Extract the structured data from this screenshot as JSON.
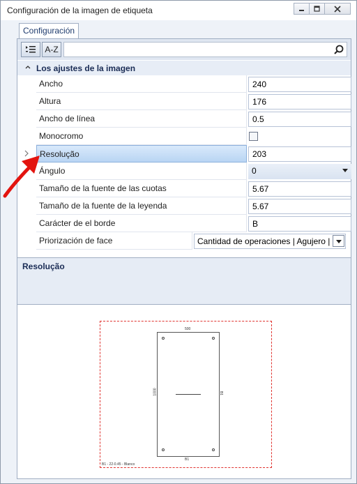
{
  "window": {
    "title": "Configuración de la imagen de etiqueta",
    "buttons": [
      "minimize",
      "maximize",
      "close"
    ]
  },
  "tabs": [
    {
      "label": "Configuración",
      "active": true
    }
  ],
  "toolbar": {
    "categorized_icon": "categorized-list-icon",
    "alphabetical_label": "A-Z",
    "search_placeholder": "",
    "search_icon": "search-icon"
  },
  "category": {
    "label": "Los ajustes de la imagen",
    "expanded": true
  },
  "properties": [
    {
      "name": "Ancho",
      "value": "240",
      "type": "text"
    },
    {
      "name": "Altura",
      "value": "176",
      "type": "text"
    },
    {
      "name": "Ancho de línea",
      "value": "0.5",
      "type": "text"
    },
    {
      "name": "Monocromo",
      "value": "",
      "type": "checkbox",
      "checked": false
    },
    {
      "name": "Resolução",
      "value": "203",
      "type": "text",
      "selected": true
    },
    {
      "name": "Ángulo",
      "value": "0",
      "type": "dropdown"
    },
    {
      "name": "Tamaño de la fuente de las cuotas",
      "value": "5.67",
      "type": "text"
    },
    {
      "name": "Tamaño de la fuente de la leyenda",
      "value": "5.67",
      "type": "text"
    },
    {
      "name": "Carácter de el borde",
      "value": "B",
      "type": "text"
    },
    {
      "name": "Priorización de face",
      "value": "Cantidad de operaciones | Agujero | (",
      "type": "combo"
    }
  ],
  "description": {
    "title": "Resolução"
  },
  "preview": {
    "dim_top": "500",
    "dim_left": "1000",
    "dim_right": "B1",
    "dim_bottom": "B1",
    "legend": "B1 - 22-0.45 - Blanco"
  },
  "colors": {
    "accent_blue": "#1a2c55",
    "selection": "#b9d5f3",
    "preview_frame": "#e0332f",
    "annotation_arrow": "#e3140f"
  }
}
